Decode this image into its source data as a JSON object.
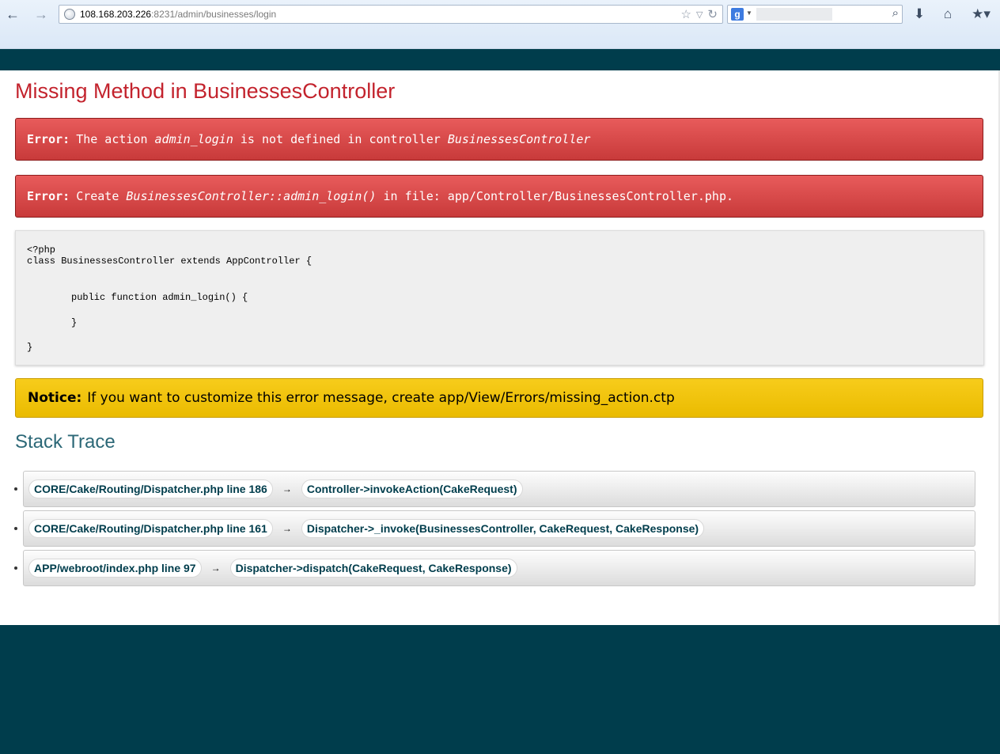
{
  "browser": {
    "url_host": "108.168.203.226",
    "url_path": ":8231/admin/businesses/login"
  },
  "page": {
    "title": "Missing Method in BusinessesController",
    "error1": {
      "label": "Error:",
      "pre": "The action",
      "action": "admin_login",
      "mid": "is not defined in controller",
      "controller": "BusinessesController"
    },
    "error2": {
      "label": "Error:",
      "pre": "Create",
      "method": "BusinessesController::admin_login()",
      "post": "in file: app/Controller/BusinessesController.php."
    },
    "code_lines": [
      "<?php",
      "class BusinessesController extends AppController {",
      "public function admin_login() {",
      "}",
      "}"
    ],
    "notice": {
      "label": "Notice:",
      "text": "If you want to customize this error message, create app/View/Errors/missing_action.ctp"
    },
    "stack_title": "Stack Trace",
    "arrow": "→",
    "stack": [
      {
        "file": "CORE/Cake/Routing/Dispatcher.php line 186",
        "call": "Controller->invokeAction(CakeRequest)"
      },
      {
        "file": "CORE/Cake/Routing/Dispatcher.php line 161",
        "call": "Dispatcher->_invoke(BusinessesController, CakeRequest, CakeResponse)"
      },
      {
        "file": "APP/webroot/index.php line 97",
        "call": "Dispatcher->dispatch(CakeRequest, CakeResponse)"
      }
    ]
  },
  "icons": {
    "back": "back-arrow-icon",
    "forward": "forward-arrow-icon",
    "bookmark": "star-icon",
    "reload": "reload-icon",
    "search": "magnifier-icon",
    "download": "download-icon",
    "home": "home-icon"
  }
}
